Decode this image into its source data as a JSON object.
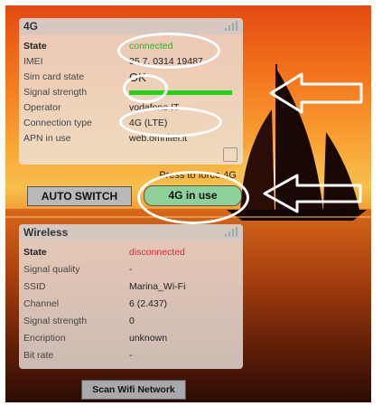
{
  "panel_4g": {
    "title": "4G",
    "rows": [
      {
        "key": "State",
        "value": "connected"
      },
      {
        "key": "IMEI",
        "value": "35 7. 0314 19487"
      },
      {
        "key": "Sim card state",
        "value": "OK"
      },
      {
        "key": "Signal strength",
        "value": ""
      },
      {
        "key": "Operator",
        "value": "vodafone IT"
      },
      {
        "key": "Connection type",
        "value": "4G (LTE)"
      },
      {
        "key": "APN in use",
        "value": "web.omnitel.it"
      }
    ],
    "signal_level": 0.95
  },
  "force_hint": "Press to force 4G",
  "auto_switch_label": "AUTO SWITCH",
  "mode_label": "4G in use",
  "panel_wireless": {
    "title": "Wireless",
    "rows": [
      {
        "key": "State",
        "value": "disconnected"
      },
      {
        "key": "Signal quality",
        "value": "-"
      },
      {
        "key": "SSID",
        "value": "Marina_Wi-Fi"
      },
      {
        "key": "Channel",
        "value": "6 (2.437)"
      },
      {
        "key": "Signal strength",
        "value": "0"
      },
      {
        "key": "Encription",
        "value": "unknown"
      },
      {
        "key": "Bit rate",
        "value": "-"
      }
    ]
  },
  "scan_button_label": "Scan Wifi Network",
  "colors": {
    "connected": "#2fae28",
    "disconnected": "#d8293a",
    "signal_bar": "#22d415",
    "button_green": "#8fd19a"
  },
  "icons": [
    "signal-icon",
    "edit-icon",
    "arrow-icon"
  ]
}
